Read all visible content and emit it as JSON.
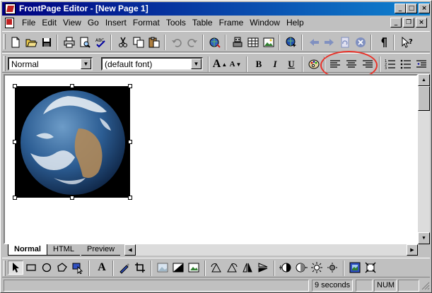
{
  "window": {
    "title": "FrontPage Editor - [New Page 1]",
    "controls": {
      "minimize": "_",
      "maximize": "□",
      "close": "×"
    }
  },
  "menu": {
    "items": [
      "File",
      "Edit",
      "View",
      "Go",
      "Insert",
      "Format",
      "Tools",
      "Table",
      "Frame",
      "Window",
      "Help"
    ],
    "mdi_controls": {
      "minimize": "_",
      "restore": "❐",
      "close": "×"
    }
  },
  "standard_toolbar": {
    "tools": [
      "new-page",
      "open",
      "save",
      "print",
      "print-preview",
      "spelling",
      "cut",
      "copy",
      "paste",
      "undo",
      "redo",
      "hyperlink",
      "webbot-component",
      "insert-table",
      "insert-image",
      "follow-link",
      "back",
      "forward",
      "refresh",
      "stop",
      "show-paragraph-marks",
      "help"
    ]
  },
  "format_toolbar": {
    "style_value": "Normal",
    "font_value": "(default font)",
    "buttons": [
      "increase-font-size",
      "decrease-font-size",
      "bold",
      "italic",
      "underline",
      "text-color",
      "align-left",
      "align-center",
      "align-right",
      "numbered-list",
      "bulleted-list",
      "decrease-indent"
    ],
    "bold_label": "B",
    "italic_label": "I",
    "underline_label": "U",
    "increase_font_label": "A",
    "decrease_font_label": "A",
    "annotation": {
      "highlighted_group": "alignment-buttons",
      "color": "#e8332a"
    }
  },
  "editor": {
    "image_description": "earth-globe-image",
    "background": "#ffffff"
  },
  "view_tabs": [
    "Normal",
    "HTML",
    "Preview"
  ],
  "active_tab": "Normal",
  "image_toolbar": {
    "tools": [
      "select",
      "rectangle",
      "circle",
      "polygon",
      "highlight-hotspots",
      "text",
      "make-transparent",
      "crop",
      "washout",
      "black-and-white",
      "restore",
      "rotate-left",
      "rotate-right",
      "reverse",
      "flip",
      "more-contrast",
      "less-contrast",
      "more-brightness",
      "less-brightness",
      "bevel",
      "resample"
    ],
    "text_label": "A"
  },
  "status": {
    "message": "",
    "time": "9 seconds",
    "num_lock": "NUM"
  },
  "colors": {
    "title_bar": "#000080",
    "face": "#c0c0c0",
    "annotation_ring": "#e8332a"
  }
}
